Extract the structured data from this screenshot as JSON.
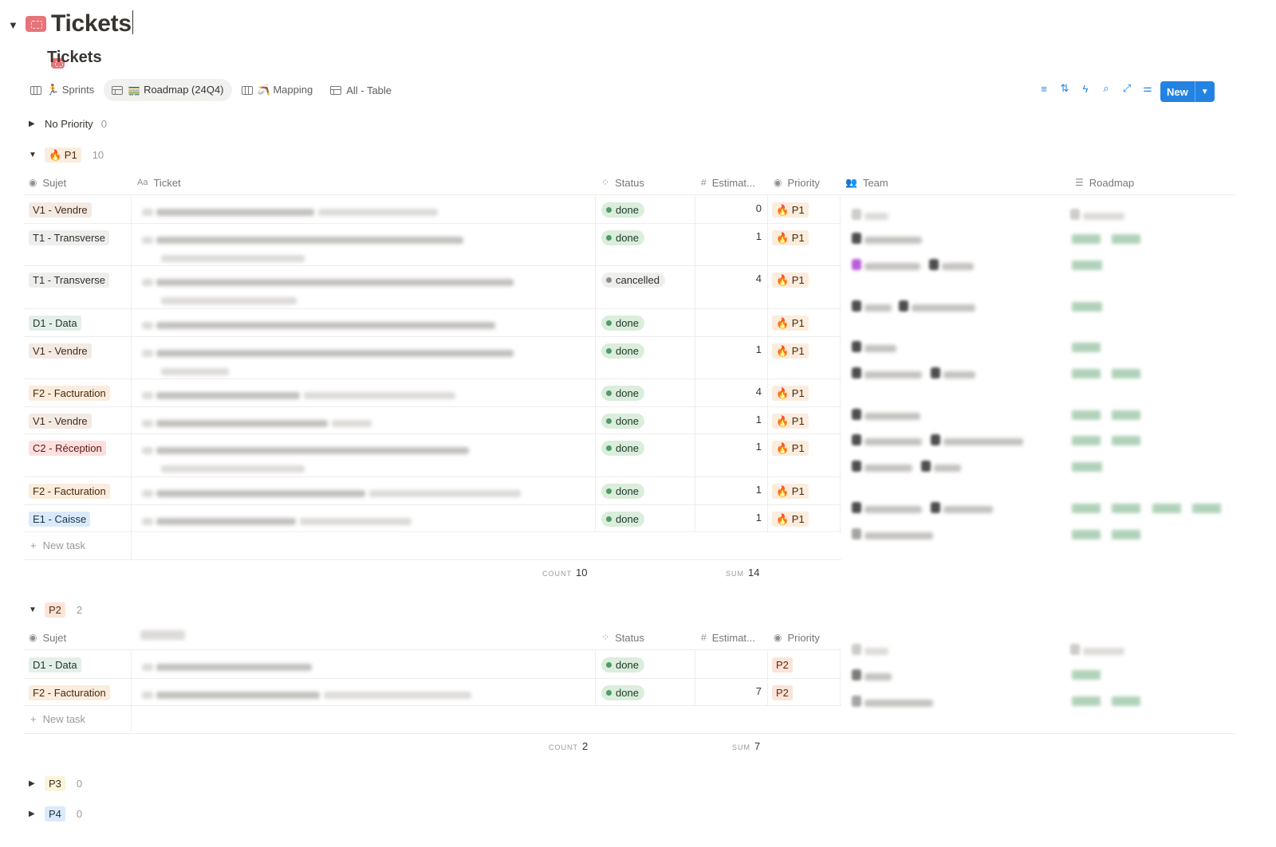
{
  "page": {
    "title": "Tickets"
  },
  "database": {
    "title": "Tickets"
  },
  "views": [
    {
      "label": "🏃 Sprints",
      "type": "board"
    },
    {
      "label": "🚃 Roadmap (24Q4)",
      "type": "table"
    },
    {
      "label": "🪃 Mapping",
      "type": "board"
    },
    {
      "label": "All - Table",
      "type": "table"
    }
  ],
  "toolbar": {
    "new_label": "New"
  },
  "columns": {
    "sujet": "Sujet",
    "ticket": "Ticket",
    "status": "Status",
    "estimate": "Estimat...",
    "priority": "Priority",
    "team": "Team",
    "roadmap": "Roadmap"
  },
  "groups": {
    "no_priority": {
      "label": "No Priority",
      "count": "0"
    },
    "p1": {
      "label": "🔥 P1",
      "count": "10",
      "rows": [
        {
          "sujet": "V1 - Vendre",
          "status": "done",
          "estimate": "0",
          "priority": "🔥 P1"
        },
        {
          "sujet": "T1 - Transverse",
          "status": "done",
          "estimate": "1",
          "priority": "🔥 P1"
        },
        {
          "sujet": "T1 - Transverse",
          "status": "cancelled",
          "estimate": "4",
          "priority": "🔥 P1"
        },
        {
          "sujet": "D1 - Data",
          "status": "done",
          "estimate": "",
          "priority": "🔥 P1"
        },
        {
          "sujet": "V1 - Vendre",
          "status": "done",
          "estimate": "1",
          "priority": "🔥 P1"
        },
        {
          "sujet": "F2 - Facturation",
          "status": "done",
          "estimate": "4",
          "priority": "🔥 P1"
        },
        {
          "sujet": "V1 - Vendre",
          "status": "done",
          "estimate": "1",
          "priority": "🔥 P1"
        },
        {
          "sujet": "C2 - Réception",
          "status": "done",
          "estimate": "1",
          "priority": "🔥 P1"
        },
        {
          "sujet": "F2 - Facturation",
          "status": "done",
          "estimate": "1",
          "priority": "🔥 P1"
        },
        {
          "sujet": "E1 - Caisse",
          "status": "done",
          "estimate": "1",
          "priority": "🔥 P1"
        }
      ],
      "new_task": "New task",
      "count_label": "COUNT",
      "count_value": "10",
      "sum_label": "SUM",
      "sum_value": "14"
    },
    "p2": {
      "label": "P2",
      "count": "2",
      "rows": [
        {
          "sujet": "D1 - Data",
          "status": "done",
          "estimate": "",
          "priority": "P2"
        },
        {
          "sujet": "F2 - Facturation",
          "status": "done",
          "estimate": "7",
          "priority": "P2"
        }
      ],
      "new_task": "New task",
      "count_label": "COUNT",
      "count_value": "2",
      "sum_label": "SUM",
      "sum_value": "7"
    },
    "p3": {
      "label": "P3",
      "count": "0"
    },
    "p4": {
      "label": "P4",
      "count": "0"
    }
  },
  "colors": {
    "accent": "#2383e2",
    "done": "#dbeddb",
    "cancelled": "#eeeeed",
    "p1_tag": "#fbecdd"
  }
}
